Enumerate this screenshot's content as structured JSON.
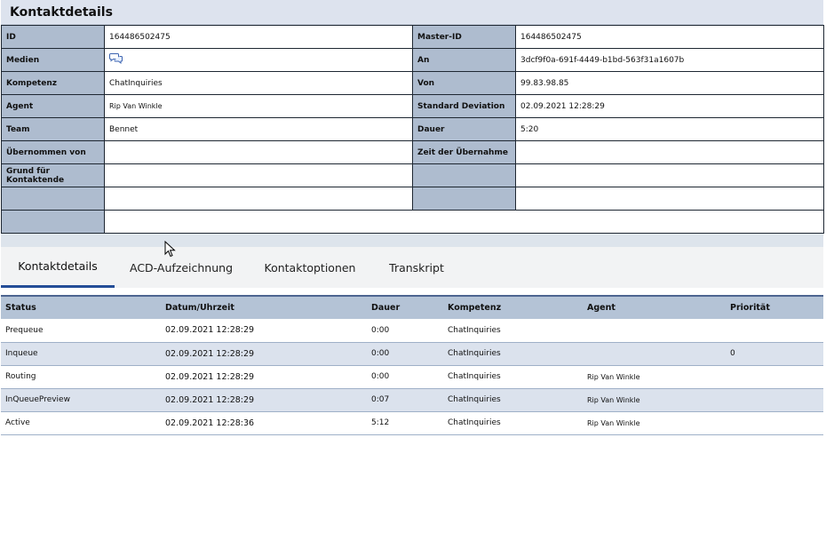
{
  "header": {
    "title": "Kontaktdetails"
  },
  "details": {
    "rows": [
      {
        "l1": "ID",
        "v1": "164486502475",
        "l2": "Master-ID",
        "v2": "164486502475"
      },
      {
        "l1": "Medien",
        "v1": "",
        "l2": "An",
        "v2": "3dcf9f0a-691f-4449-b1bd-563f31a1607b"
      },
      {
        "l1": "Kompetenz",
        "v1": "ChatInquiries",
        "l2": "Von",
        "v2": "99.83.98.85"
      },
      {
        "l1": "Agent",
        "v1": "Rip Van Winkle",
        "l2": "Standard Deviation",
        "v2": "02.09.2021 12:28:29"
      },
      {
        "l1": "Team",
        "v1": "Bennet",
        "l2": "Dauer",
        "v2": "5:20"
      },
      {
        "l1": "Übernommen von",
        "v1": "",
        "l2": "Zeit der Übernahme",
        "v2": ""
      },
      {
        "l1": "Grund für Kontaktende",
        "v1": "",
        "l2": "",
        "v2": ""
      },
      {
        "l1": "",
        "v1": "",
        "l2": "",
        "v2": ""
      }
    ],
    "medien_icon": "chat-bubbles-icon"
  },
  "tabs": [
    {
      "label": "Kontaktdetails",
      "active": true
    },
    {
      "label": "ACD-Aufzeichnung",
      "active": false
    },
    {
      "label": "Kontaktoptionen",
      "active": false
    },
    {
      "label": "Transkript",
      "active": false
    }
  ],
  "status_table": {
    "headers": [
      "Status",
      "Datum/Uhrzeit",
      "Dauer",
      "Kompetenz",
      "Agent",
      "Priorität"
    ],
    "rows": [
      {
        "status": "Prequeue",
        "datetime": "02.09.2021 12:28:29",
        "duration": "0:00",
        "skill": "ChatInquiries",
        "agent": "",
        "priority": ""
      },
      {
        "status": "Inqueue",
        "datetime": "02.09.2021 12:28:29",
        "duration": "0:00",
        "skill": "ChatInquiries",
        "agent": "",
        "priority": "0"
      },
      {
        "status": "Routing",
        "datetime": "02.09.2021 12:28:29",
        "duration": "0:00",
        "skill": "ChatInquiries",
        "agent": "Rip Van Winkle",
        "priority": ""
      },
      {
        "status": "InQueuePreview",
        "datetime": "02.09.2021 12:28:29",
        "duration": "0:07",
        "skill": "ChatInquiries",
        "agent": "Rip Van Winkle",
        "priority": ""
      },
      {
        "status": "Active",
        "datetime": "02.09.2021 12:28:36",
        "duration": "5:12",
        "skill": "ChatInquiries",
        "agent": "Rip Van Winkle",
        "priority": ""
      }
    ]
  },
  "colors": {
    "label_bg": "#aebccf",
    "header_bg": "#b4c3d6",
    "alt_row_bg": "#dbe2ed",
    "tab_underline": "#244d97"
  }
}
